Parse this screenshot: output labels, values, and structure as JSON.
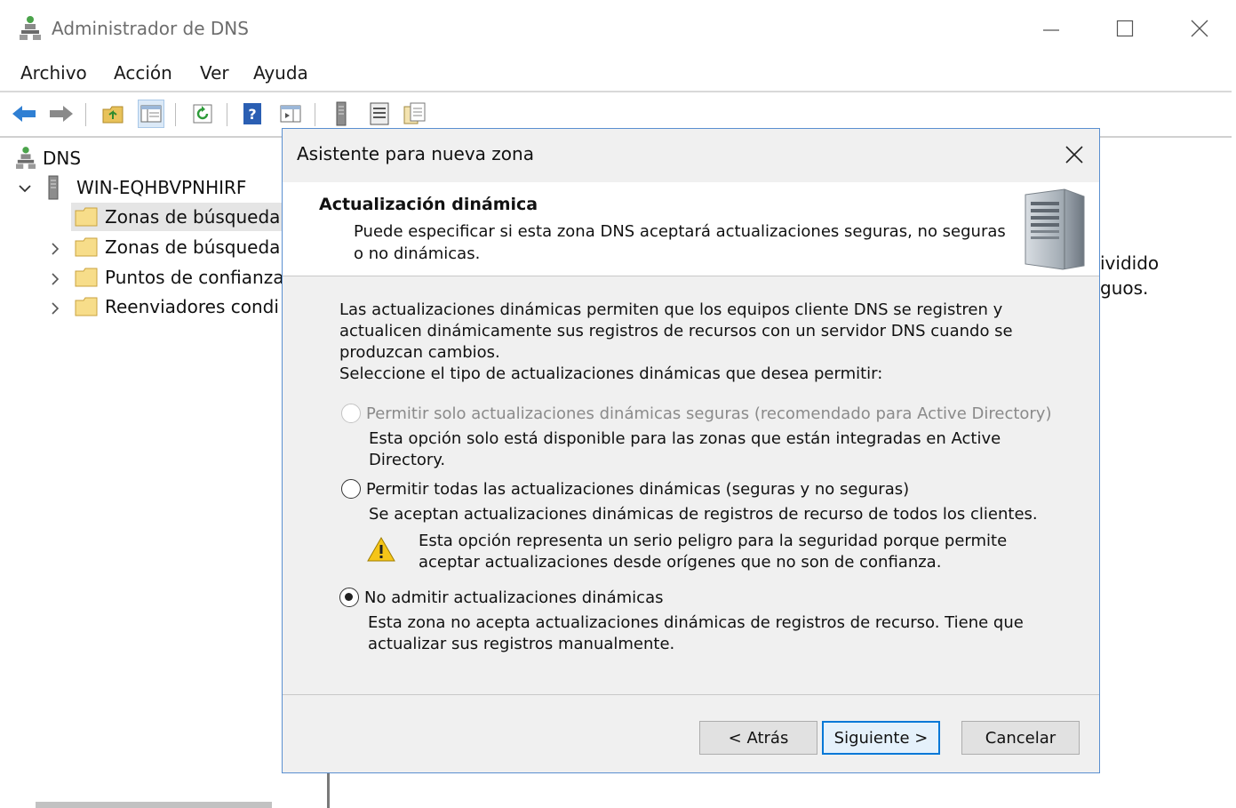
{
  "window": {
    "title": "Administrador de DNS"
  },
  "menu": [
    "Archivo",
    "Acción",
    "Ver",
    "Ayuda"
  ],
  "tree": {
    "root": "DNS",
    "server": "WIN-EQHBVPNHIRF",
    "items": [
      {
        "label": "Zonas de búsqueda",
        "selected": true
      },
      {
        "label": "Zonas de búsqueda",
        "selected": false
      },
      {
        "label": "Puntos de confianza",
        "selected": false
      },
      {
        "label": "Reenviadores condi",
        "selected": false
      }
    ]
  },
  "right_panel": {
    "line1": "ividido",
    "line2": "guos."
  },
  "dialog": {
    "title": "Asistente para nueva zona",
    "header_title": "Actualización dinámica",
    "header_subtitle": "Puede especificar si esta zona DNS aceptará actualizaciones seguras, no seguras o no dinámicas.",
    "intro": "Las actualizaciones dinámicas permiten que los equipos cliente DNS se registren y actualicen dinámicamente sus registros de recursos con un servidor DNS cuando se produzcan cambios.",
    "prompt": "Seleccione el tipo de actualizaciones dinámicas que desea permitir:",
    "options": [
      {
        "label": "Permitir solo actualizaciones dinámicas seguras (recomendado para Active Directory)",
        "description": "Esta opción solo está disponible para las zonas que están integradas en Active Directory.",
        "enabled": false,
        "checked": false
      },
      {
        "label": "Permitir todas las actualizaciones dinámicas (seguras y no seguras)",
        "description": "Se aceptan actualizaciones dinámicas de registros de recurso de todos los clientes.",
        "warning": "Esta opción representa un serio peligro para la seguridad porque permite aceptar actualizaciones desde orígenes que no son de confianza.",
        "enabled": true,
        "checked": false
      },
      {
        "label": "No admitir actualizaciones dinámicas",
        "description": "Esta zona no acepta actualizaciones dinámicas de registros de recurso. Tiene que actualizar sus registros manualmente.",
        "enabled": true,
        "checked": true
      }
    ],
    "buttons": {
      "back": "< Atrás",
      "next": "Siguiente >",
      "cancel": "Cancelar"
    }
  },
  "colors": {
    "dialog_border": "#5a8fd0",
    "dialog_bg": "#f0f0f0",
    "default_button_border": "#0078d7",
    "selection_bg": "#e5e5e5"
  }
}
